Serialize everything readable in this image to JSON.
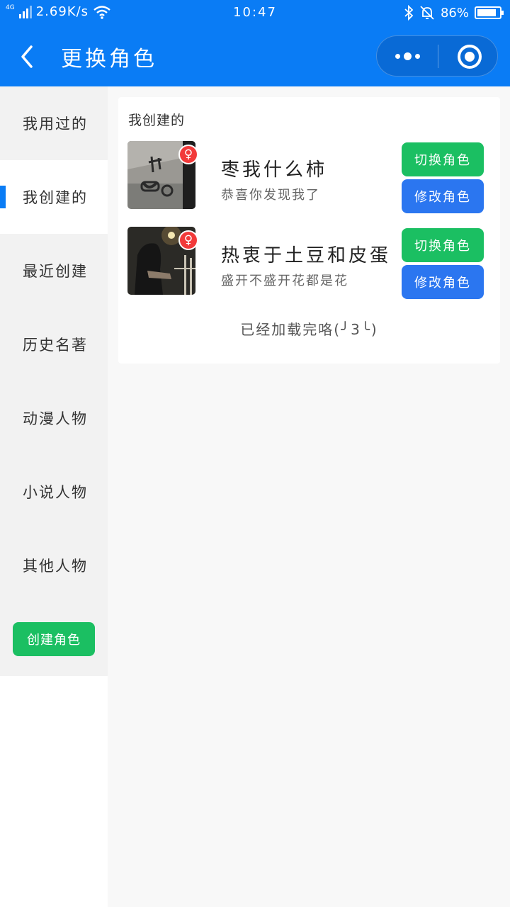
{
  "status_bar": {
    "network": "4G",
    "speed": "2.69K/s",
    "time": "10:47",
    "battery": "86%",
    "battery_level": 0.86
  },
  "nav": {
    "title": "更换角色"
  },
  "sidebar": {
    "items": [
      {
        "label": "我用过的"
      },
      {
        "label": "我创建的"
      },
      {
        "label": "最近创建"
      },
      {
        "label": "历史名著"
      },
      {
        "label": "动漫人物"
      },
      {
        "label": "小说人物"
      },
      {
        "label": "其他人物"
      }
    ],
    "create_button": "创建角色"
  },
  "main": {
    "heading": "我创建的",
    "roles": [
      {
        "name": "枣我什么柿",
        "desc": "恭喜你发现我了",
        "gender_symbol": "♀",
        "switch_label": "切换角色",
        "edit_label": "修改角色"
      },
      {
        "name": "热衷于土豆和皮蛋",
        "desc": "盛开不盛开花都是花",
        "gender_symbol": "♀",
        "switch_label": "切换角色",
        "edit_label": "修改角色"
      }
    ],
    "loaded_text": "已经加载完咯(╯3╰)"
  },
  "colors": {
    "primary": "#0a7cf5",
    "switch": "#1bbf62",
    "edit": "#2b76f0",
    "gender_badge": "#f23a3a"
  }
}
